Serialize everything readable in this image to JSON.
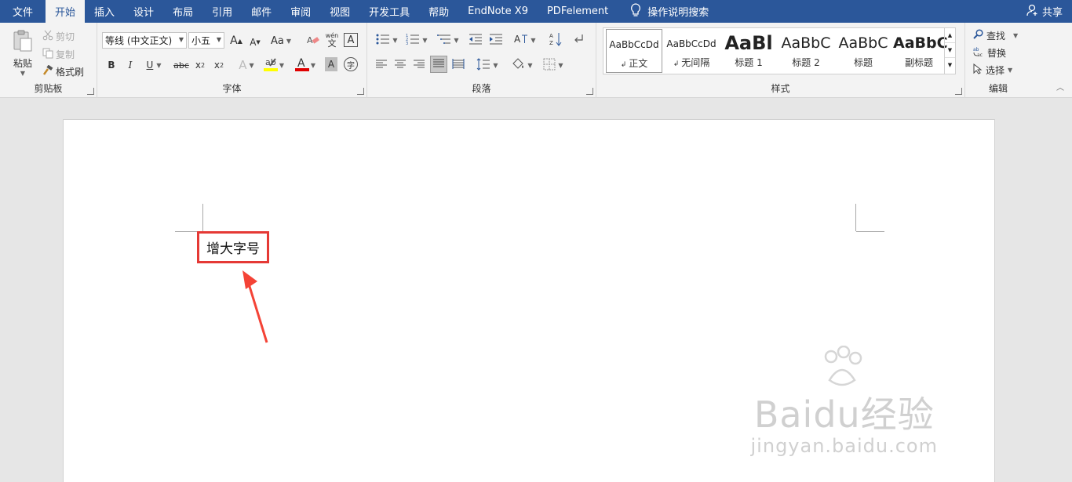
{
  "tabs": [
    {
      "label": "文件"
    },
    {
      "label": "开始"
    },
    {
      "label": "插入"
    },
    {
      "label": "设计"
    },
    {
      "label": "布局"
    },
    {
      "label": "引用"
    },
    {
      "label": "邮件"
    },
    {
      "label": "审阅"
    },
    {
      "label": "视图"
    },
    {
      "label": "开发工具"
    },
    {
      "label": "帮助"
    },
    {
      "label": "EndNote X9"
    },
    {
      "label": "PDFelement"
    }
  ],
  "tell_me": "操作说明搜索",
  "share": "共享",
  "clipboard": {
    "paste": "粘贴",
    "cut": "剪切",
    "copy": "复制",
    "format_painter": "格式刷",
    "label": "剪贴板"
  },
  "font": {
    "name": "等线 (中文正文)",
    "size": "小五",
    "grow": "A",
    "shrink": "A",
    "case": "Aa",
    "phonetic": "wén",
    "phonetic_char": "文",
    "bold": "B",
    "italic": "I",
    "underline": "U",
    "strike": "abc",
    "subscript": "x",
    "superscript": "x",
    "sub_mark": "2",
    "sup_mark": "2",
    "label": "字体"
  },
  "paragraph": {
    "label": "段落"
  },
  "styles": {
    "label": "样式",
    "items": [
      {
        "preview": "AaBbCcDd",
        "name": "正文"
      },
      {
        "preview": "AaBbCcDd",
        "name": "无间隔"
      },
      {
        "preview": "AaBl",
        "name": "标题 1"
      },
      {
        "preview": "AaBbC",
        "name": "标题 2"
      },
      {
        "preview": "AaBbC",
        "name": "标题"
      },
      {
        "preview": "AaBbC",
        "name": "副标题"
      }
    ]
  },
  "editing": {
    "find": "查找",
    "replace": "替换",
    "select": "选择",
    "label": "编辑"
  },
  "document": {
    "text": "增大字号"
  },
  "watermark": {
    "main": "Baidu经验",
    "sub": "jingyan.baidu.com"
  },
  "colors": {
    "accent": "#2b579a",
    "highlight_box": "#e53935",
    "arrow": "#f44336",
    "font_color": "#e00000",
    "highlight_color": "#ffff00"
  }
}
